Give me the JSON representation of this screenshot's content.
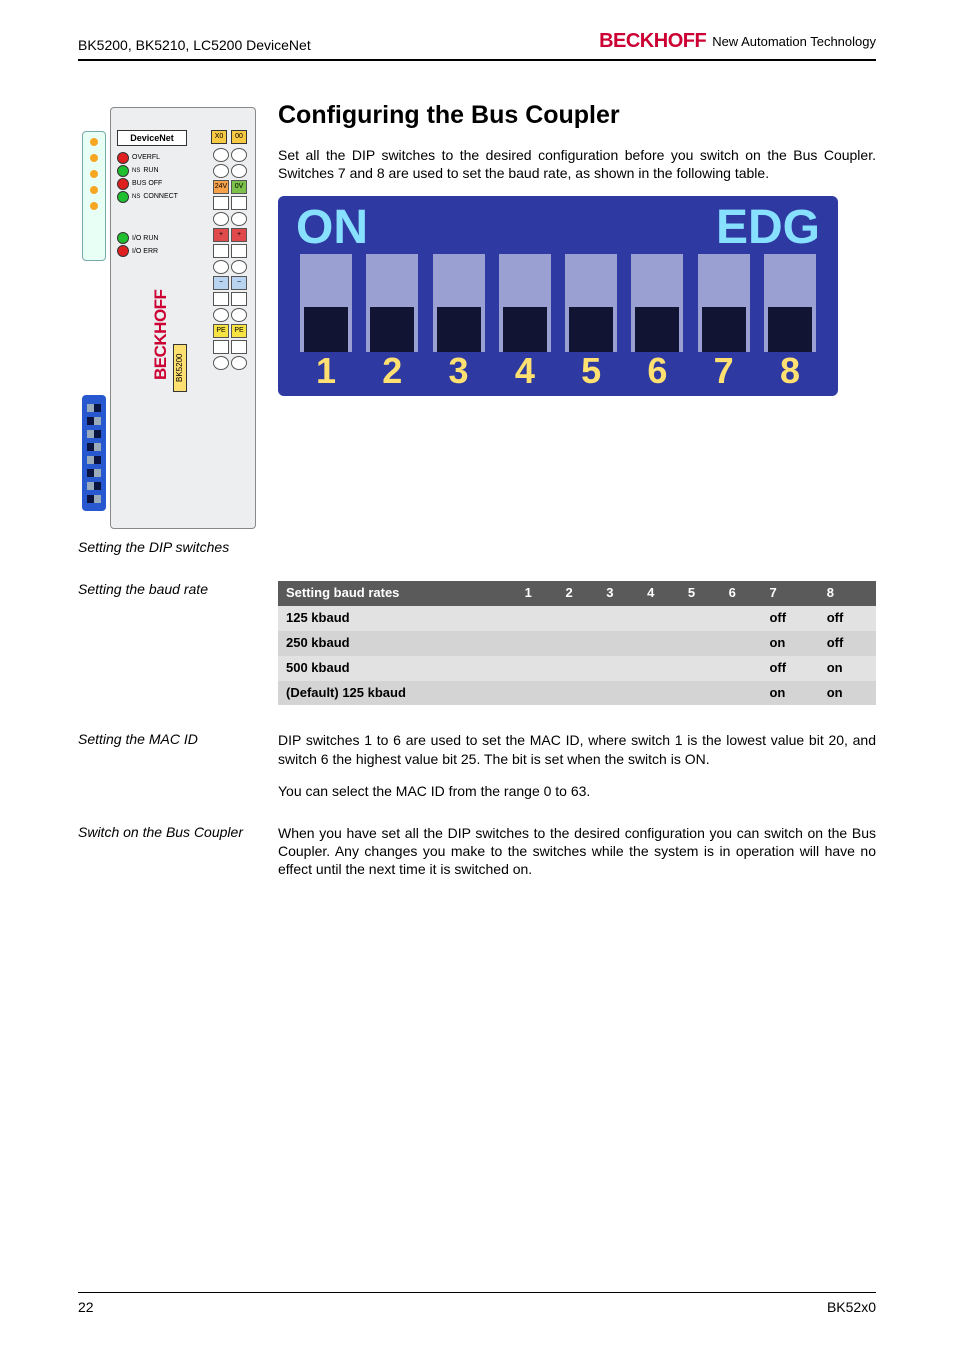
{
  "header": {
    "doc_title": "BK5200, BK5210, LC5200 DeviceNet",
    "brand_name": "BECKHOFF",
    "brand_tagline": "New Automation Technology"
  },
  "section": {
    "heading": "Configuring the Bus Coupler",
    "intro": "Set all the DIP switches to the desired configuration before you switch on the Bus Coupler. Switches 7 and 8 are used to set the baud rate, as shown in the following table."
  },
  "module": {
    "devnet_label": "DeviceNet",
    "x0": "X0",
    "o0": "00",
    "leds": {
      "overfl": "OVERFL",
      "ns_run": "RUN",
      "busoff": "BUS OFF",
      "ns_connect": "CONNECT",
      "io_run": "I/O RUN",
      "io_err": "I/O ERR",
      "ns1": "NS",
      "ns2": "NS"
    },
    "term_labels": {
      "v24": "24V",
      "ov": "0V",
      "plus": "+",
      "minus": "−",
      "pe": "PE"
    },
    "brand_vert": "BECKHOFF",
    "bk_tag": "BK5200",
    "caption": "Setting the DIP switches"
  },
  "dip": {
    "label_on": "ON",
    "label_edg": "EDG",
    "numbers": [
      "1",
      "2",
      "3",
      "4",
      "5",
      "6",
      "7",
      "8"
    ]
  },
  "baud_section_label": "Setting the baud rate",
  "chart_data": {
    "type": "table",
    "title": "Setting baud rates",
    "columns": [
      "Setting baud rates",
      "1",
      "2",
      "3",
      "4",
      "5",
      "6",
      "7",
      "8"
    ],
    "rows": [
      {
        "rate": "125 kbaud",
        "sw": [
          "",
          "",
          "",
          "",
          "",
          "",
          "off",
          "off"
        ]
      },
      {
        "rate": "250 kbaud",
        "sw": [
          "",
          "",
          "",
          "",
          "",
          "",
          "on",
          "off"
        ]
      },
      {
        "rate": "500 kbaud",
        "sw": [
          "",
          "",
          "",
          "",
          "",
          "",
          "off",
          "on"
        ]
      },
      {
        "rate": "(Default) 125 kbaud",
        "sw": [
          "",
          "",
          "",
          "",
          "",
          "",
          "on",
          "on"
        ]
      }
    ]
  },
  "mac": {
    "label": "Setting the MAC ID",
    "p1": "DIP switches 1 to 6 are used to set the MAC ID, where switch 1 is the lowest value bit 20, and switch 6 the highest value bit 25. The bit is set when the switch is ON.",
    "p2": "You can select the MAC ID from the range 0 to 63."
  },
  "switch_on": {
    "label": "Switch on the Bus Coupler",
    "p1": "When you have set all the DIP switches to the desired configuration you can switch on the Bus Coupler. Any changes you make to the switches while the system is in operation will have no effect until the next time it is switched on."
  },
  "footer": {
    "page_num": "22",
    "doc_code": "BK52x0"
  }
}
